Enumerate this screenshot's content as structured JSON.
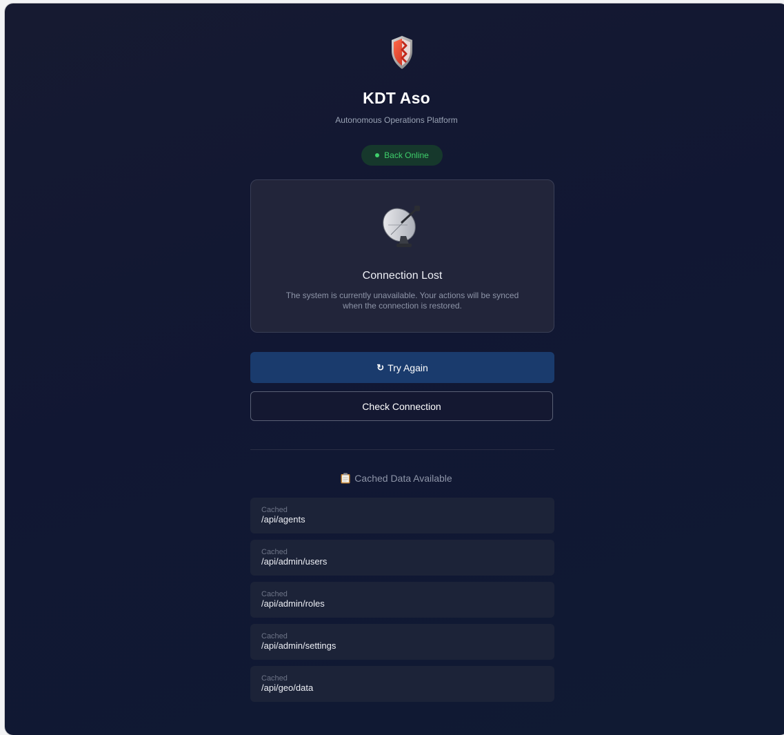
{
  "app": {
    "title": "KDT Aso",
    "subtitle": "Autonomous Operations Platform"
  },
  "status": {
    "label": "Back Online",
    "color": "#3fcf6b"
  },
  "card": {
    "icon": "satellite-dish-icon",
    "title": "Connection Lost",
    "description": "The system is currently unavailable. Your actions will be synced when the connection is restored."
  },
  "buttons": {
    "retry_icon": "↻",
    "retry_label": "Try Again",
    "check_label": "Check Connection"
  },
  "cache": {
    "heading": "Cached Data Available",
    "heading_icon": "clipboard-icon",
    "items": [
      {
        "label": "Cached",
        "path": "/api/agents"
      },
      {
        "label": "Cached",
        "path": "/api/admin/users"
      },
      {
        "label": "Cached",
        "path": "/api/admin/roles"
      },
      {
        "label": "Cached",
        "path": "/api/admin/settings"
      },
      {
        "label": "Cached",
        "path": "/api/geo/data"
      }
    ]
  },
  "colors": {
    "background": "#131833",
    "primary_button": "#1a3b6d",
    "status_bg": "#16382c"
  }
}
